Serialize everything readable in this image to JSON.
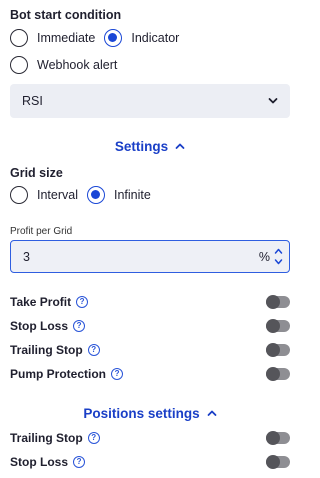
{
  "bot_start": {
    "label": "Bot start condition",
    "options": [
      {
        "label": "Immediate",
        "selected": false
      },
      {
        "label": "Indicator",
        "selected": true
      },
      {
        "label": "Webhook alert",
        "selected": false
      }
    ],
    "indicator_select": {
      "value": "RSI"
    }
  },
  "settings": {
    "title": "Settings",
    "grid_size": {
      "label": "Grid size",
      "options": [
        {
          "label": "Interval",
          "selected": false
        },
        {
          "label": "Infinite",
          "selected": true
        }
      ]
    },
    "profit_per_grid": {
      "label": "Profit per Grid",
      "value": "3",
      "suffix": "%"
    },
    "toggles": [
      {
        "label": "Take Profit",
        "on": false
      },
      {
        "label": "Stop Loss",
        "on": false
      },
      {
        "label": "Trailing Stop",
        "on": false
      },
      {
        "label": "Pump Protection",
        "on": false
      }
    ]
  },
  "positions_settings": {
    "title": "Positions settings",
    "toggles": [
      {
        "label": "Trailing Stop",
        "on": false
      },
      {
        "label": "Stop Loss",
        "on": false
      }
    ]
  },
  "colors": {
    "accent": "#1a47d6",
    "heading_accent": "#1a3fc7",
    "field_bg": "#eceef4",
    "toggle_off": "#8e8e93"
  },
  "icons": {
    "help": "question-circle-icon",
    "select": "chevron-down-icon",
    "collapse": "chevron-up-icon",
    "stepper_up": "caret-up-icon",
    "stepper_down": "caret-down-icon"
  }
}
